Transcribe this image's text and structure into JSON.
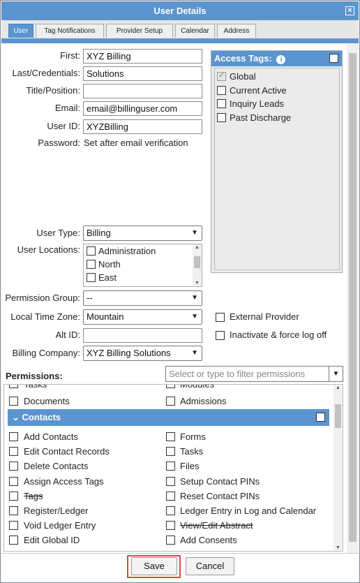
{
  "dialog": {
    "title": "User Details",
    "close_glyph": "×"
  },
  "tabs": [
    {
      "label": "User",
      "active": true
    },
    {
      "label": "Tag Notifications",
      "active": false
    },
    {
      "label": "Provider Setup",
      "active": false
    },
    {
      "label": "Calendar",
      "active": false
    },
    {
      "label": "Address",
      "active": false
    }
  ],
  "form": {
    "first_label": "First:",
    "first_value": "XYZ Billing",
    "last_label": "Last/Credentials:",
    "last_value": "Solutions",
    "title_label": "Title/Position:",
    "title_value": "",
    "email_label": "Email:",
    "email_value": "email@billinguser.com",
    "userid_label": "User ID:",
    "userid_value": "XYZBilling",
    "password_label": "Password:",
    "password_value": "Set after email verification",
    "user_type_label": "User Type:",
    "user_type_value": "Billing",
    "user_locations_label": "User Locations:",
    "user_locations": [
      "Administration",
      "North",
      "East"
    ],
    "permission_group_label": "Permission Group:",
    "permission_group_value": "--",
    "time_zone_label": "Local Time Zone:",
    "time_zone_value": "Mountain",
    "alt_id_label": "Alt ID:",
    "alt_id_value": "",
    "billing_company_label": "Billing Company:",
    "billing_company_value": "XYZ Billing Solutions",
    "external_provider_label": "External Provider",
    "inactivate_label": "Inactivate & force log off"
  },
  "access_tags": {
    "header": "Access Tags:",
    "info_glyph": "i",
    "items": [
      {
        "label": "Global",
        "checked": true
      },
      {
        "label": "Current Active",
        "checked": false
      },
      {
        "label": "Inquiry Leads",
        "checked": false
      },
      {
        "label": "Past Discharge",
        "checked": false
      }
    ]
  },
  "permissions": {
    "label": "Permissions:",
    "filter_placeholder": "Select or type to filter permissions",
    "top_partial": {
      "left": "Tasks",
      "right": "Modules"
    },
    "top_row": {
      "left": "Documents",
      "right": "Admissions"
    },
    "group": "Contacts",
    "rows": [
      {
        "left": "Add Contacts",
        "right": "Forms",
        "left_strike": false,
        "right_strike": false
      },
      {
        "left": "Edit Contact Records",
        "right": "Tasks",
        "left_strike": false,
        "right_strike": false
      },
      {
        "left": "Delete Contacts",
        "right": "Files",
        "left_strike": false,
        "right_strike": false
      },
      {
        "left": "Assign Access Tags",
        "right": "Setup Contact PINs",
        "left_strike": false,
        "right_strike": false
      },
      {
        "left": "Tags",
        "right": "Reset Contact PINs",
        "left_strike": true,
        "right_strike": false
      },
      {
        "left": "Register/Ledger",
        "right": "Ledger Entry in Log and Calendar",
        "left_strike": false,
        "right_strike": false
      },
      {
        "left": "Void Ledger Entry",
        "right": "View/Edit Abstract",
        "left_strike": false,
        "right_strike": true
      },
      {
        "left": "Edit Global ID",
        "right": "Add Consents",
        "left_strike": false,
        "right_strike": false
      }
    ]
  },
  "footer": {
    "save_label": "Save",
    "cancel_label": "Cancel"
  },
  "colors": {
    "accent": "#5b95cf",
    "highlight": "#e04545"
  }
}
